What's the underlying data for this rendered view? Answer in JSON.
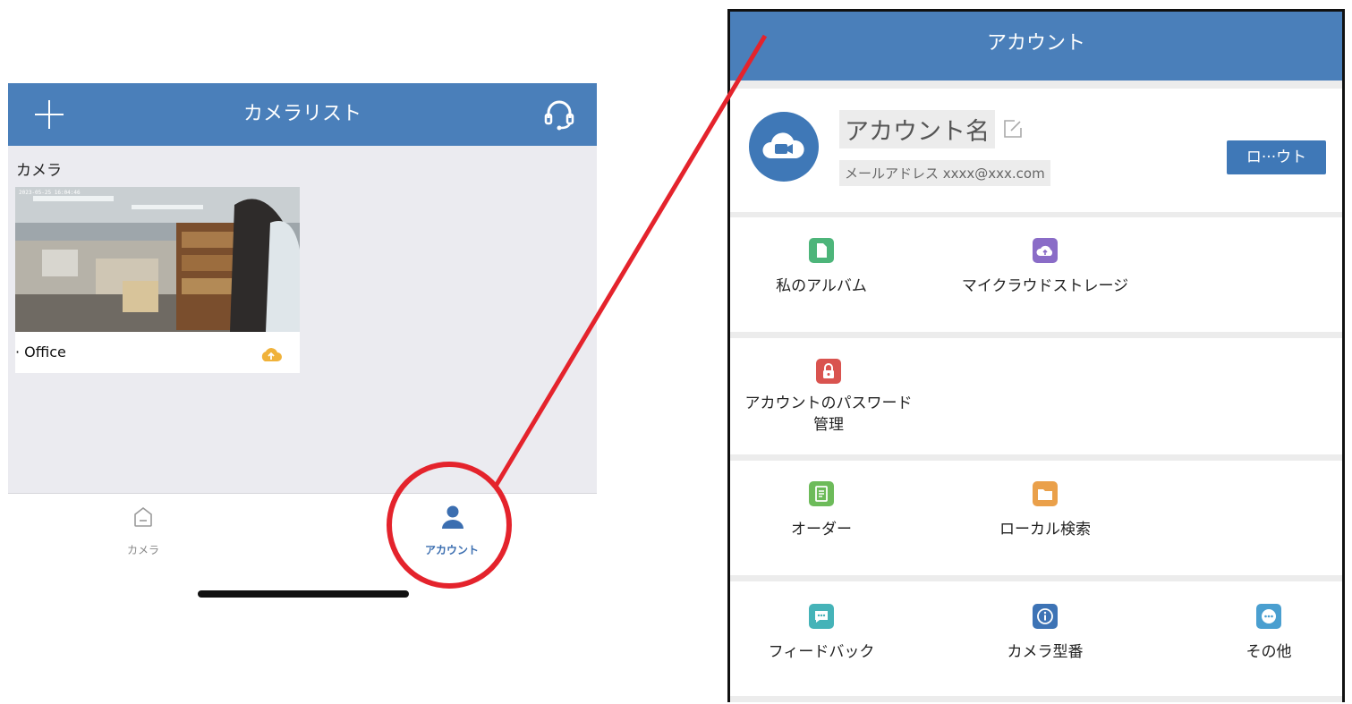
{
  "left_screen": {
    "header": {
      "title": "カメラリスト",
      "add_icon": "plus-icon",
      "support_icon": "headset-icon"
    },
    "section_label": "カメラ",
    "camera": {
      "timestamp": "2023-05-25 16:04:46",
      "name": "· Office",
      "cloud_icon": "cloud-upload-icon"
    },
    "tabs": [
      {
        "label": "カメラ",
        "icon": "home-icon",
        "active": false
      },
      {
        "label": "アカウント",
        "icon": "person-icon",
        "active": true
      }
    ]
  },
  "right_screen": {
    "header": {
      "title": "アカウント"
    },
    "profile": {
      "account_name": "アカウント名",
      "email": "メールアドレス xxxx@xxx.com",
      "logout_label": "ロ···ウト",
      "avatar_icon": "cloud-camera-icon"
    },
    "menu_rows": [
      [
        {
          "label": "私のアルバム",
          "icon": "file-icon",
          "color": "#4db57a"
        },
        {
          "label": "マイクラウドストレージ",
          "icon": "cloud-upload-icon",
          "color": "#8a6cc7"
        }
      ],
      [
        {
          "label": "アカウントのパスワード\n管理",
          "icon": "lock-icon",
          "color": "#d9534f"
        }
      ],
      [
        {
          "label": "オーダー",
          "icon": "document-icon",
          "color": "#6dbb5a"
        },
        {
          "label": "ローカル検索",
          "icon": "folder-icon",
          "color": "#eaa04a"
        }
      ],
      [
        {
          "label": "フィードバック",
          "icon": "chat-icon",
          "color": "#45b3b8"
        },
        {
          "label": "カメラ型番",
          "icon": "info-icon",
          "color": "#3d73b5"
        },
        {
          "label": "その他",
          "icon": "more-icon",
          "color": "#4a9fd0"
        }
      ]
    ]
  },
  "colors": {
    "header_blue": "#4a7fba",
    "highlight_red": "#e4232c"
  }
}
